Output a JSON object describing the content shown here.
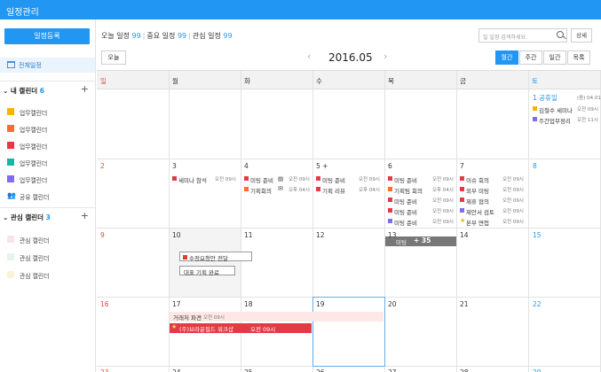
{
  "app": {
    "title": "일정관리"
  },
  "sidebar": {
    "register_label": "일정등록",
    "all_label": "전체일정",
    "my_cal": {
      "label": "내 캘린더",
      "count": "6",
      "plus": "+"
    },
    "my_items": [
      {
        "label": "업무캘린더",
        "color": "#f5b400"
      },
      {
        "label": "업무캘린더",
        "color": "#ff6d2e"
      },
      {
        "label": "업무캘린더",
        "color": "#e53945"
      },
      {
        "label": "업무캘린더",
        "color": "#1ab6a5"
      },
      {
        "label": "업무캘린더",
        "color": "#7d6df0"
      },
      {
        "label": "공유 캘린더",
        "icon": "people-icon"
      }
    ],
    "interest_cal": {
      "label": "관심 캘린더",
      "count": "3",
      "plus": "+"
    },
    "interest_items": [
      {
        "label": "관심 캘린더",
        "color": "#fbe4e4"
      },
      {
        "label": "관심 캘린더",
        "color": "#e4f4ea"
      },
      {
        "label": "관심 캘린더",
        "color": "#fbf3d8"
      }
    ]
  },
  "summary": {
    "today_label": "오늘 일정",
    "today_count": "99",
    "important_label": "중요 일정",
    "important_count": "99",
    "interest_label": "관심 일정",
    "interest_count": "99"
  },
  "search": {
    "placeholder": "일 일정 검색하세요.",
    "detail_label": "상세"
  },
  "toolbar": {
    "today_label": "오늘",
    "prev": "‹",
    "next": "›",
    "month": "2016.05",
    "views": [
      {
        "label": "월간",
        "active": true
      },
      {
        "label": "주간",
        "active": false
      },
      {
        "label": "일간",
        "active": false
      },
      {
        "label": "목록",
        "active": false
      }
    ]
  },
  "calendar": {
    "weekdays": [
      "일",
      "월",
      "화",
      "수",
      "목",
      "금",
      "토"
    ],
    "weeks": [
      [
        "",
        "",
        "",
        "",
        "",
        "",
        "1 공휴일"
      ],
      [
        "2",
        "3",
        "4",
        "5 +",
        "6",
        "7",
        "8"
      ],
      [
        "9",
        "10",
        "11",
        "12",
        "13",
        "14",
        "15"
      ],
      [
        "16",
        "17",
        "18",
        "19",
        "20",
        "21",
        "22"
      ],
      [
        "23",
        "24",
        "25",
        "26",
        "27",
        "28",
        "29"
      ]
    ],
    "holiday_lunar": "(음) 04.01",
    "events": {
      "sat1": [
        {
          "title": "김철수 세미나",
          "time": "오전 09시",
          "color": "#f5b400"
        },
        {
          "title": "주간업무정리",
          "time": "오전 11시",
          "color": "#7d6df0"
        }
      ],
      "mon3": [
        {
          "title": "세미나 참석",
          "time": "오전 09시",
          "color": "#e53945"
        }
      ],
      "tue4": [
        {
          "title": "미팅 준비",
          "time": "오전 09시",
          "color": "#e53945"
        },
        {
          "title": "기획회의",
          "time": "오후 04시",
          "color": "#ff6d2e"
        }
      ],
      "wed5": [
        {
          "title": "미팅 준비",
          "time": "오전 09시",
          "color": "#e53945"
        },
        {
          "title": "기획 리뷰",
          "time": "오후 04시",
          "color": "#e53945"
        }
      ],
      "thu6": [
        {
          "title": "미팅 준비",
          "time": "오전 09시",
          "color": "#e53945"
        },
        {
          "title": "기획팀 회의",
          "time": "오후 04시",
          "color": "#ff6d2e"
        },
        {
          "title": "미팅 준비",
          "time": "오전 09시",
          "color": "#e53945"
        },
        {
          "title": "미팅 준비",
          "time": "오전 09시",
          "color": "#e53945"
        },
        {
          "title": "미팅 준비",
          "time": "오전 09시",
          "color": "#7d6df0"
        }
      ],
      "thu6_more": {
        "prefix": "미팅 ",
        "label": "+ 35"
      },
      "fri7": [
        {
          "title": "이슈 회의",
          "time": "오전 09시",
          "color": "#e53945"
        },
        {
          "title": "외부 미팅",
          "time": "오전 09시",
          "color": "#e53945"
        },
        {
          "title": "제휴 협의",
          "time": "오전 09시",
          "color": "#e53945"
        },
        {
          "title": "제안서 검토",
          "time": "오전 09시",
          "color": "#7d6df0"
        },
        {
          "title": "본부 면접",
          "time": "오전 09시",
          "color": "#f5b400",
          "star": true
        }
      ],
      "mon10": [
        {
          "title": "수정요청안 전달"
        },
        {
          "title": "대표 기획 완료"
        }
      ],
      "week17_span1": {
        "title": "거래처 파견",
        "time": "오전 09시"
      },
      "week17_span2": {
        "title": "(주)브라운필드 워크샵",
        "time": "오전 09시"
      }
    }
  }
}
